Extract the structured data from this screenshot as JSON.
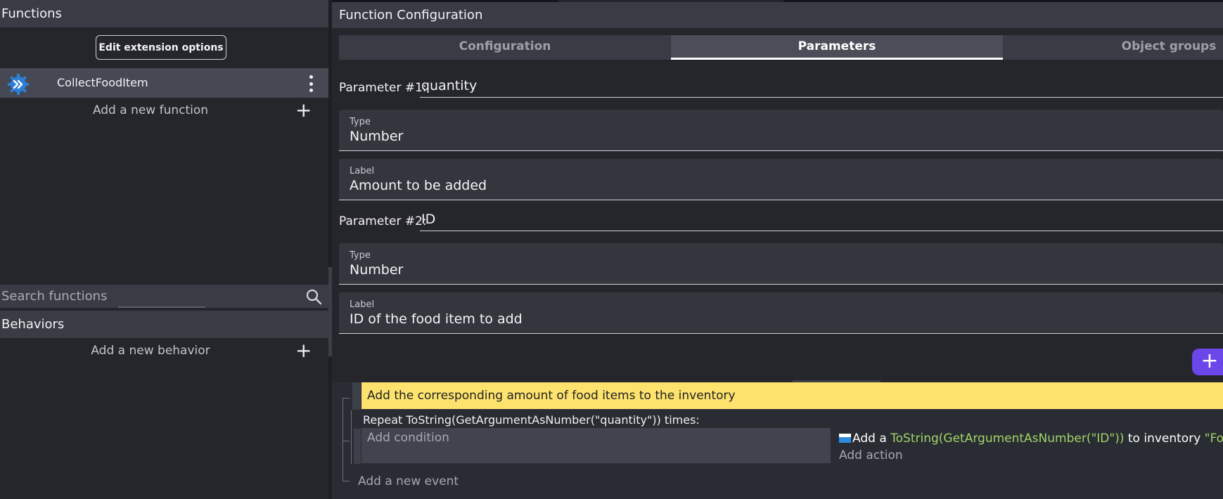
{
  "left_panel": {
    "functions_header": "Functions",
    "edit_extension_label": "Edit extension options",
    "function_item": {
      "name": "CollectFoodItem",
      "icon": "extension-gear-icon"
    },
    "add_function_label": "Add a new function",
    "search_placeholder": "Search functions",
    "behaviors_header": "Behaviors",
    "add_behavior_label": "Add a new behavior"
  },
  "right_panel": {
    "header": "Function Configuration",
    "tabs": [
      {
        "label": "Configuration",
        "active": false
      },
      {
        "label": "Parameters",
        "active": true
      },
      {
        "label": "Object groups",
        "active": false
      }
    ],
    "parameters": [
      {
        "title": "Parameter #1:",
        "name": "quantity",
        "type_caption": "Type",
        "type_value": "Number",
        "label_caption": "Label",
        "label_value": "Amount to be added"
      },
      {
        "title": "Parameter #2:",
        "name": "ID",
        "type_caption": "Type",
        "type_value": "Number",
        "label_caption": "Label",
        "label_value": "ID of the food item to add"
      }
    ],
    "add_parameter_fab": "+"
  },
  "events": {
    "comment": "Add the corresponding amount of food items to the inventory",
    "repeat": "Repeat ToString(GetArgumentAsNumber(\"quantity\")) times:",
    "add_condition": "Add condition",
    "action": {
      "prefix": "Add a ",
      "expression": "ToString(GetArgumentAsNumber(\"ID\"))",
      "middle": " to inventory ",
      "inventory": "\"Food\""
    },
    "add_action": "Add action",
    "add_event": "Add a new event"
  },
  "colors": {
    "accent_fab": "#6b46e8",
    "comment_bg": "#fde36e",
    "expression_green": "#a0d468"
  }
}
